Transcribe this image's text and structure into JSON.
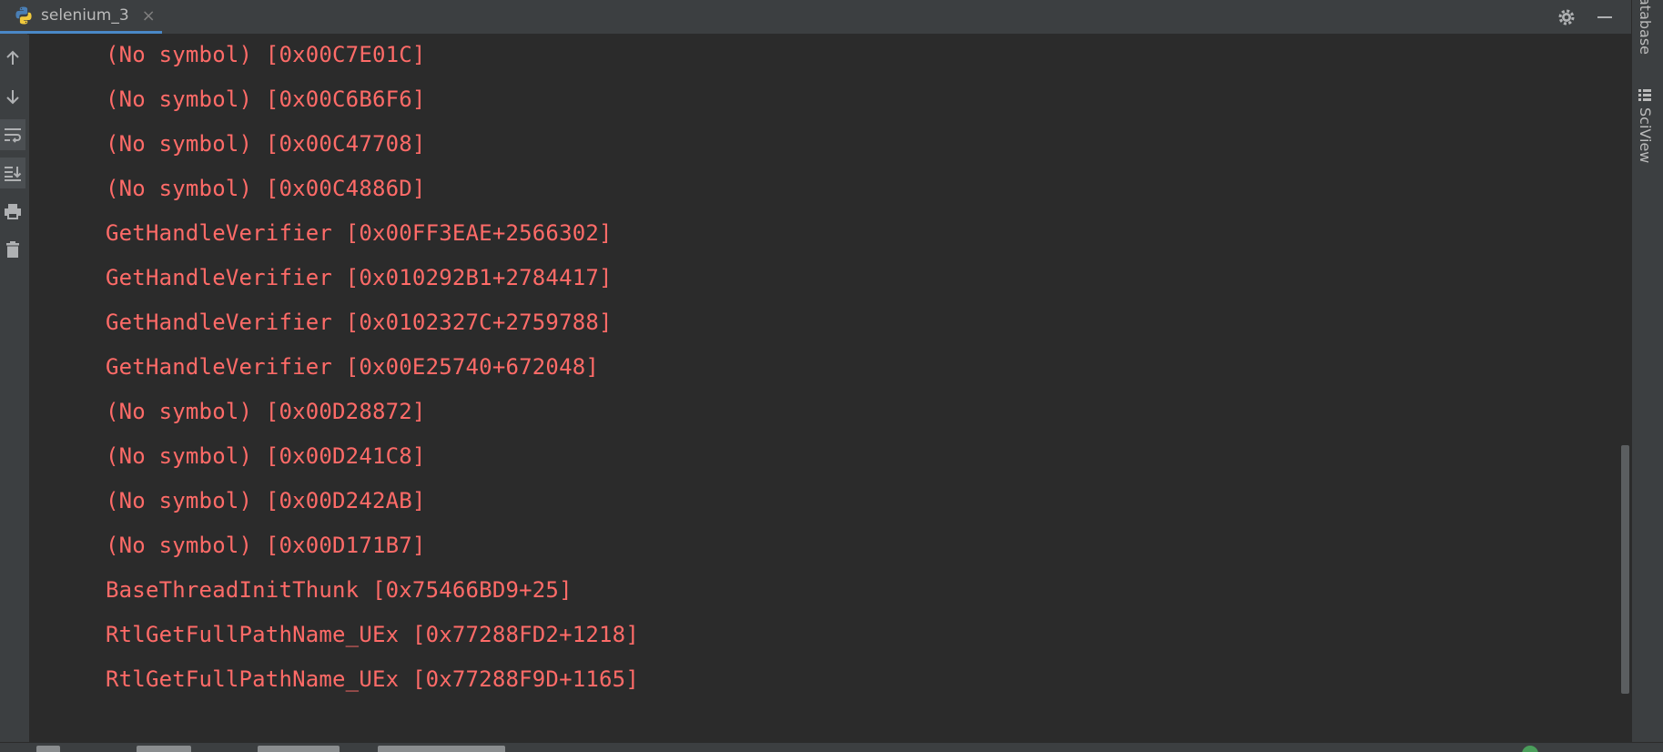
{
  "tab": {
    "title": "selenium_3",
    "close_glyph": "×",
    "icon": "python-icon"
  },
  "toolbar_right": {
    "settings_icon": "gear-icon",
    "minimize_icon": "minimize-icon"
  },
  "left_toolbar": [
    {
      "name": "up-arrow-icon"
    },
    {
      "name": "down-arrow-icon"
    },
    {
      "name": "soft-wrap-icon"
    },
    {
      "name": "scroll-to-end-icon"
    },
    {
      "name": "print-icon"
    },
    {
      "name": "trash-icon"
    }
  ],
  "console": {
    "text_color": "#ff6b68",
    "lines": [
      "(No symbol) [0x00C7E01C]",
      "(No symbol) [0x00C6B6F6]",
      "(No symbol) [0x00C47708]",
      "(No symbol) [0x00C4886D]",
      "GetHandleVerifier [0x00FF3EAE+2566302]",
      "GetHandleVerifier [0x010292B1+2784417]",
      "GetHandleVerifier [0x0102327C+2759788]",
      "GetHandleVerifier [0x00E25740+672048]",
      "(No symbol) [0x00D28872]",
      "(No symbol) [0x00D241C8]",
      "(No symbol) [0x00D242AB]",
      "(No symbol) [0x00D171B7]",
      "BaseThreadInitThunk [0x75466BD9+25]",
      "RtlGetFullPathName_UEx [0x77288FD2+1218]",
      "RtlGetFullPathName_UEx [0x77288F9D+1165]"
    ]
  },
  "right_sidebar": {
    "database_label": "atabase",
    "sciview_label": "SciView"
  },
  "colors": {
    "accent": "#4a88c7",
    "background": "#2b2b2b",
    "chrome": "#3c3f41"
  }
}
